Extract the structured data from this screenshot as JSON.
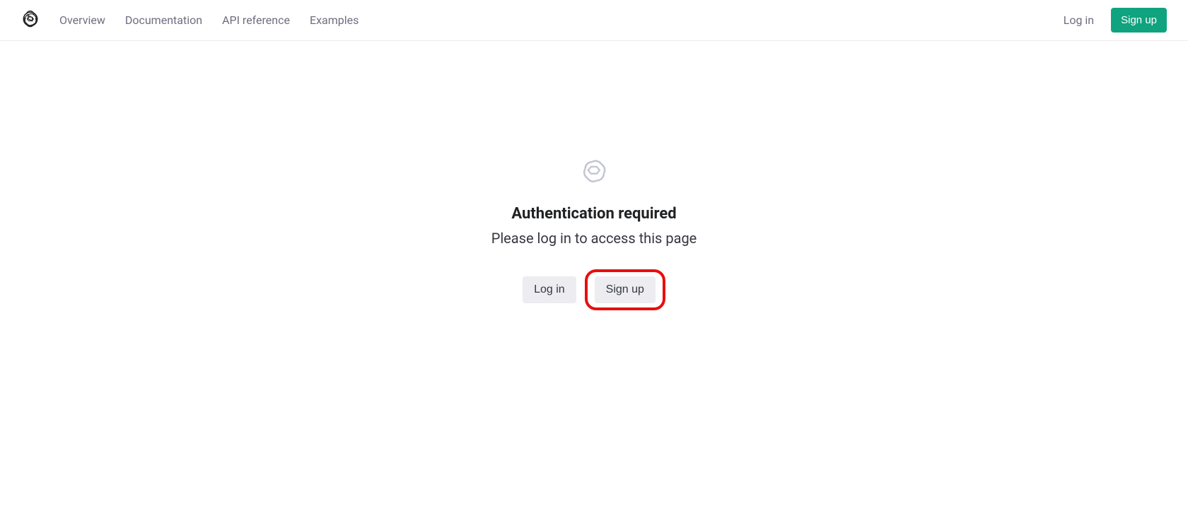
{
  "header": {
    "nav": {
      "overview": "Overview",
      "documentation": "Documentation",
      "api_reference": "API reference",
      "examples": "Examples"
    },
    "login": "Log in",
    "signup": "Sign up"
  },
  "main": {
    "title": "Authentication required",
    "subtitle": "Please log in to access this page",
    "login_btn": "Log in",
    "signup_btn": "Sign up"
  }
}
